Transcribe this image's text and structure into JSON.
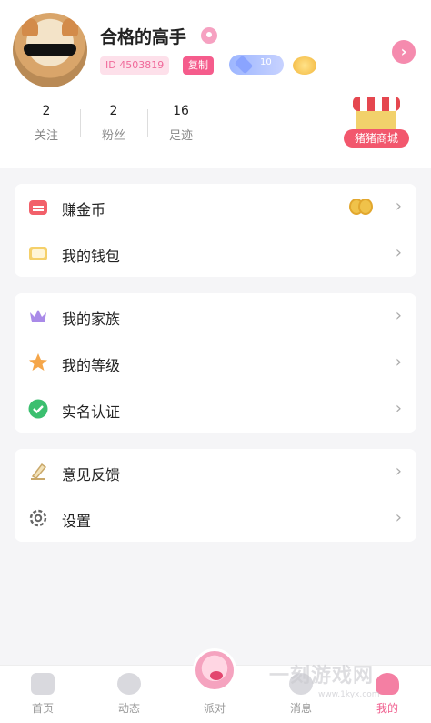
{
  "profile": {
    "username": "合格的高手",
    "id_label": "ID 4503819",
    "copy_label": "复制",
    "level_value": "10"
  },
  "stats": [
    {
      "value": "2",
      "label": "关注"
    },
    {
      "value": "2",
      "label": "粉丝"
    },
    {
      "value": "16",
      "label": "足迹"
    }
  ],
  "shop": {
    "label": "猪猪商城"
  },
  "menu_groups": [
    [
      {
        "label": "赚金币",
        "icon": "red-wallet-icon"
      },
      {
        "label": "我的钱包",
        "icon": "wallet-icon"
      }
    ],
    [
      {
        "label": "我的家族",
        "icon": "crown-icon"
      },
      {
        "label": "我的等级",
        "icon": "star-icon"
      },
      {
        "label": "实名认证",
        "icon": "check-shield-icon"
      }
    ],
    [
      {
        "label": "意见反馈",
        "icon": "feedback-icon"
      },
      {
        "label": "设置",
        "icon": "gear-icon"
      }
    ]
  ],
  "tabbar": [
    {
      "label": "首页"
    },
    {
      "label": "动态"
    },
    {
      "label": "派对"
    },
    {
      "label": "消息"
    },
    {
      "label": "我的"
    }
  ],
  "watermark": {
    "text": "一刻游戏网",
    "url": "www.1kyx.com"
  },
  "colors": {
    "accent": "#f05f8f",
    "background": "#f5f5f7"
  }
}
